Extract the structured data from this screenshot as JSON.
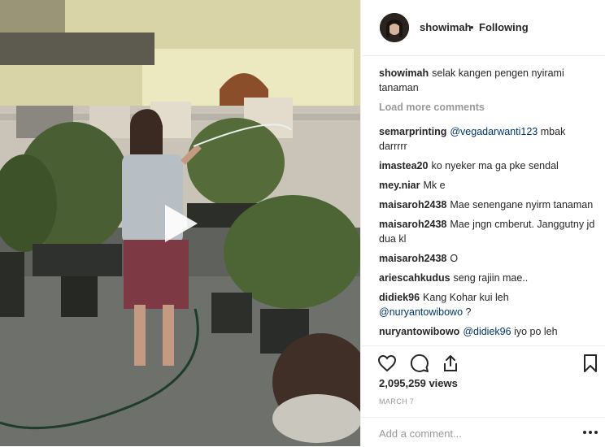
{
  "post": {
    "username": "showimah",
    "separator": "•",
    "follow_status": "Following",
    "caption_user": "showimah",
    "caption_text": "selak kangen pengen nyirami tanaman",
    "load_more": "Load more comments",
    "comments": [
      {
        "user": "semarprinting",
        "mention": "@vegadarwanti123",
        "text": "mbak darrrrr"
      },
      {
        "user": "imastea20",
        "mention": "",
        "text": "ko nyeker ma ga pke sendal"
      },
      {
        "user": "mey.niar",
        "mention": "",
        "text": "Mk e"
      },
      {
        "user": "maisaroh2438",
        "mention": "",
        "text": "Mae senengane nyirm tanaman"
      },
      {
        "user": "maisaroh2438",
        "mention": "",
        "text": "Mae jngn cmberut. Janggutny jd dua kl"
      },
      {
        "user": "maisaroh2438",
        "mention": "",
        "text": "O"
      },
      {
        "user": "ariescahkudus",
        "mention": "",
        "text": "seng rajiin mae.."
      },
      {
        "user": "didiek96",
        "mention": "",
        "text": "Kang Kohar kui leh",
        "mention_after": "@nuryantowibowo",
        "text_after": "?"
      },
      {
        "user": "nuryantowibowo",
        "mention": "@didiek96",
        "text": "iyo po leh"
      }
    ],
    "views": "2,095,259 views",
    "date": "MARCH 7",
    "add_comment_placeholder": "Add a comment..."
  },
  "icons": {
    "like": "heart-icon",
    "comment": "comment-icon",
    "share": "share-icon",
    "save": "bookmark-icon",
    "play": "play-icon",
    "options": "more-options-icon"
  }
}
